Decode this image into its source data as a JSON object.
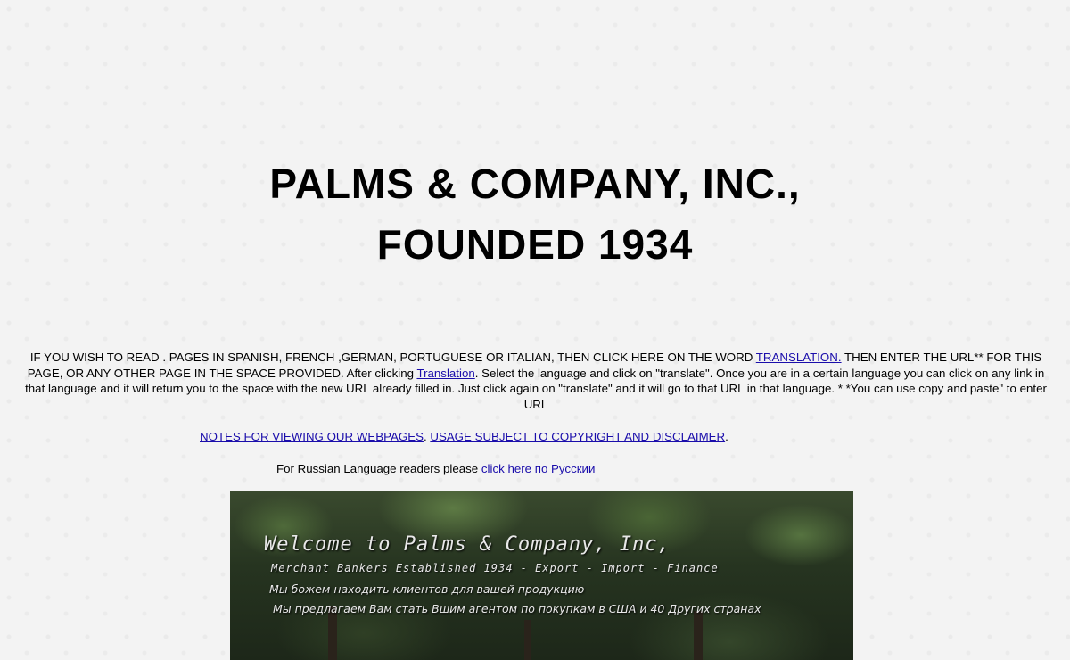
{
  "header": {
    "title_line1": "PALMS & COMPANY, INC.,",
    "title_line2": "FOUNDED 1934"
  },
  "translation_para": {
    "part1": "IF  YOU WISH TO READ . PAGES IN SPANISH, FRENCH ,GERMAN, PORTUGUESE OR ITALIAN, THEN CLICK HERE ON THE WORD ",
    "link1": "TRANSLATION.",
    "part2": " THEN ENTER THE URL** FOR THIS PAGE, OR ANY OTHER PAGE IN THE SPACE PROVIDED. After clicking ",
    "link2": "Translation",
    "part3": ". Select the language and click on \"translate\". Once you are in a certain language you can click on any link in that language and it will return you to the space with the new URL already filled in. Just click again on \"translate\" and it will go to that URL in that language. * *You can use copy and paste\" to enter URL"
  },
  "notes": {
    "link_notes": "NOTES FOR VIEWING OUR WEBPAGES",
    "sep1": ".  ",
    "link_usage": "USAGE SUBJECT TO COPYRIGHT AND DISCLAIMER",
    "sep2": "."
  },
  "russian": {
    "prefix": "For Russian Language readers please ",
    "link_click": "click here",
    "space": " ",
    "link_ru": "по Русскии"
  },
  "banner": {
    "welcome": "Welcome to Palms & Company, Inc,",
    "subtitle": "Merchant Bankers Established 1934 - Export - Import - Finance",
    "ru_line1": "Мы божем находить клиентов для вашей продукцию",
    "ru_line2": "Мы предлагаем Вам стать Вшим агентом по покупкам в США и 40 Других странах"
  }
}
